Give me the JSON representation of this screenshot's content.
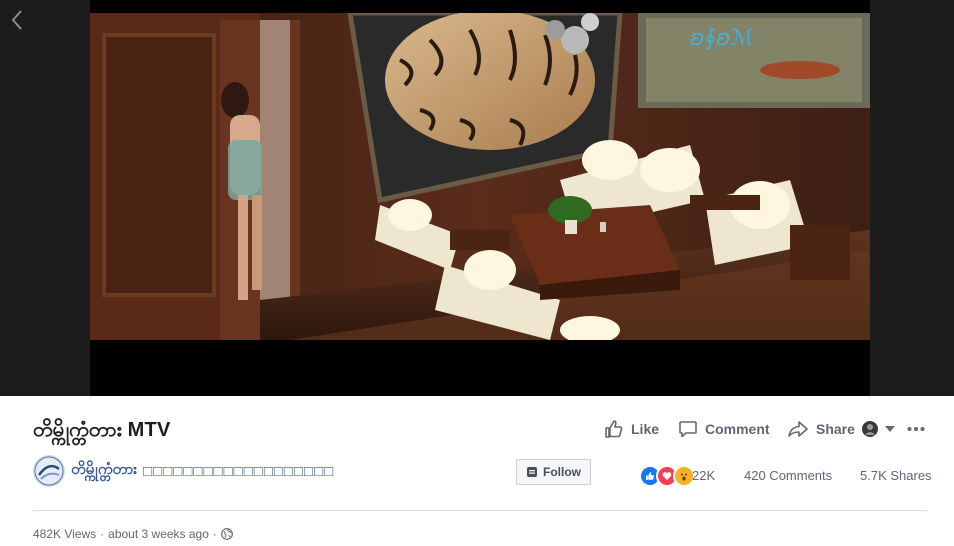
{
  "viewer": {
    "back_icon": "chevron-left-icon"
  },
  "video": {
    "title": "တိမ္ကိုက္တံတား MTV"
  },
  "actions": {
    "like": "Like",
    "comment": "Comment",
    "share": "Share"
  },
  "page": {
    "name": "တိမ္ကိုက္တံတား",
    "subtitle": "□□□□□□□□□□□□□□□□□□□",
    "follow": "Follow"
  },
  "stats": {
    "reactions": "22K",
    "comments": "420 Comments",
    "shares": "5.7K Shares"
  },
  "meta": {
    "views": "482K Views",
    "time": "about 3 weeks ago",
    "separator": "·",
    "privacy_icon": "globe-icon"
  },
  "colors": {
    "link": "#385898",
    "secondary_text": "#606770",
    "like_blue": "#1877f2",
    "love_red": "#f33e58",
    "wow_yellow": "#f7b125"
  }
}
